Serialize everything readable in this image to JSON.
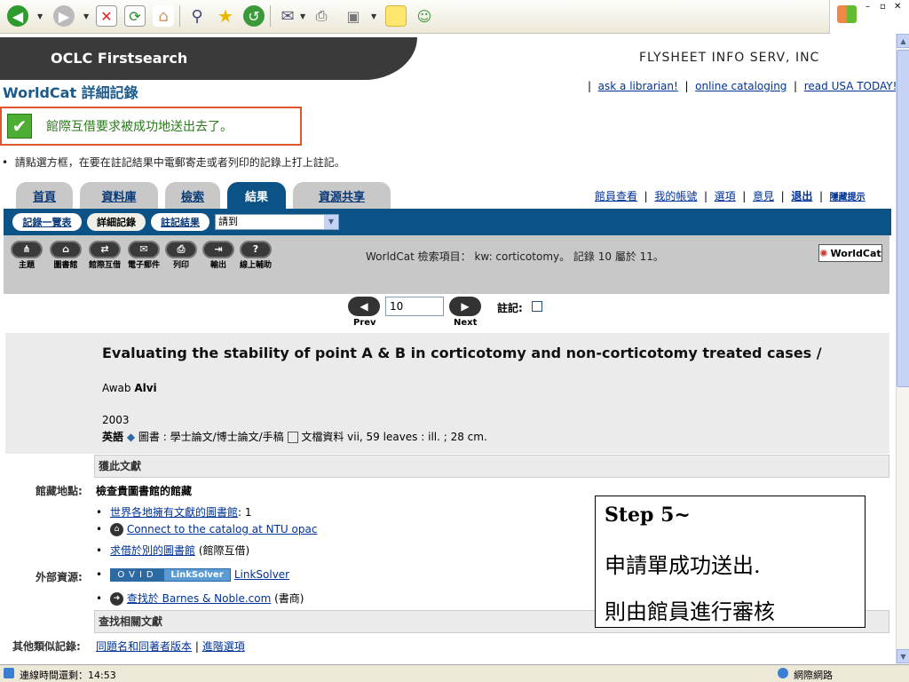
{
  "header": {
    "title": "OCLC Firstsearch",
    "org": "FLYSHEET INFO SERV, INC"
  },
  "worldcat_title": "WorldCat 詳細記錄",
  "top_links": [
    "ask a librarian!",
    "online cataloging",
    "read USA TODAY!"
  ],
  "message": "館際互借要求被成功地送出去了。",
  "hint": "請點選方框，在要在註記結果中電郵寄走或者列印的記錄上打上註記。",
  "tabs": [
    "首頁",
    "資料庫",
    "檢索",
    "結果",
    "資源共享"
  ],
  "right_links": [
    "館員查看",
    "我的帳號",
    "選項",
    "意見",
    "退出",
    "隱藏提示"
  ],
  "subtabs": [
    "記錄一覽表",
    "詳細記錄",
    "註記結果"
  ],
  "goto_select": "請到",
  "icons": [
    {
      "label": "主題",
      "icon": "tree-icon"
    },
    {
      "label": "圖書館",
      "icon": "library-icon"
    },
    {
      "label": "館際互借",
      "icon": "ill-icon"
    },
    {
      "label": "電子郵件",
      "icon": "email-icon"
    },
    {
      "label": "列印",
      "icon": "print-icon"
    },
    {
      "label": "輸出",
      "icon": "export-icon"
    },
    {
      "label": "線上輔助",
      "icon": "help-icon"
    }
  ],
  "search_info": "WorldCat 檢索項目： kw: corticotomy。 記錄 10 屬於 11。",
  "worldcat_logo": "WorldCat",
  "nav": {
    "prev": "Prev",
    "next": "Next",
    "record": "10",
    "mark": "註記:"
  },
  "record": {
    "title": "Evaluating the stability of point A & B in corticotomy and non-corticotomy treated cases /",
    "author_first": "Awab ",
    "author_last": "Alvi",
    "year": "2003",
    "lang": "英語",
    "type": "圖書 : 學士論文/博士論文/手稿",
    "desc": "文檔資料 vii, 59 leaves : ill. ; 28 cm."
  },
  "sections": {
    "get": "獲此文獻",
    "find": "查找相關文獻"
  },
  "holdings": {
    "label": "館藏地點:",
    "heading": "檢查貴圖書館的館藏",
    "item1": "世界各地擁有文獻的圖書館",
    "item1_count": ": 1",
    "item2": "Connect to the catalog at NTU opac",
    "item3": "求借於別的圖書館",
    "item3_note": " (館際互借)"
  },
  "external": {
    "label": "外部資源:",
    "ovid_a": "OVID",
    "ovid_b": "LinkSolver",
    "link": "LinkSolver",
    "bn": "查找於 Barnes & Noble.com",
    "bn_note": " (書商)"
  },
  "similar": {
    "label": "其他類似記錄:",
    "link1": "同題名和同著者版本",
    "link2": "進階選項"
  },
  "annotation": {
    "step": "Step 5~",
    "line1": "申請單成功送出.",
    "line2": "則由館員進行審核"
  },
  "status": {
    "text": "連線時間還剩：14:53",
    "zone": "網際網路"
  },
  "colors": {
    "tab_active": "#0b5287",
    "msg_border": "#e0562a",
    "msg_text": "#2a7a1a",
    "link": "#003399"
  }
}
